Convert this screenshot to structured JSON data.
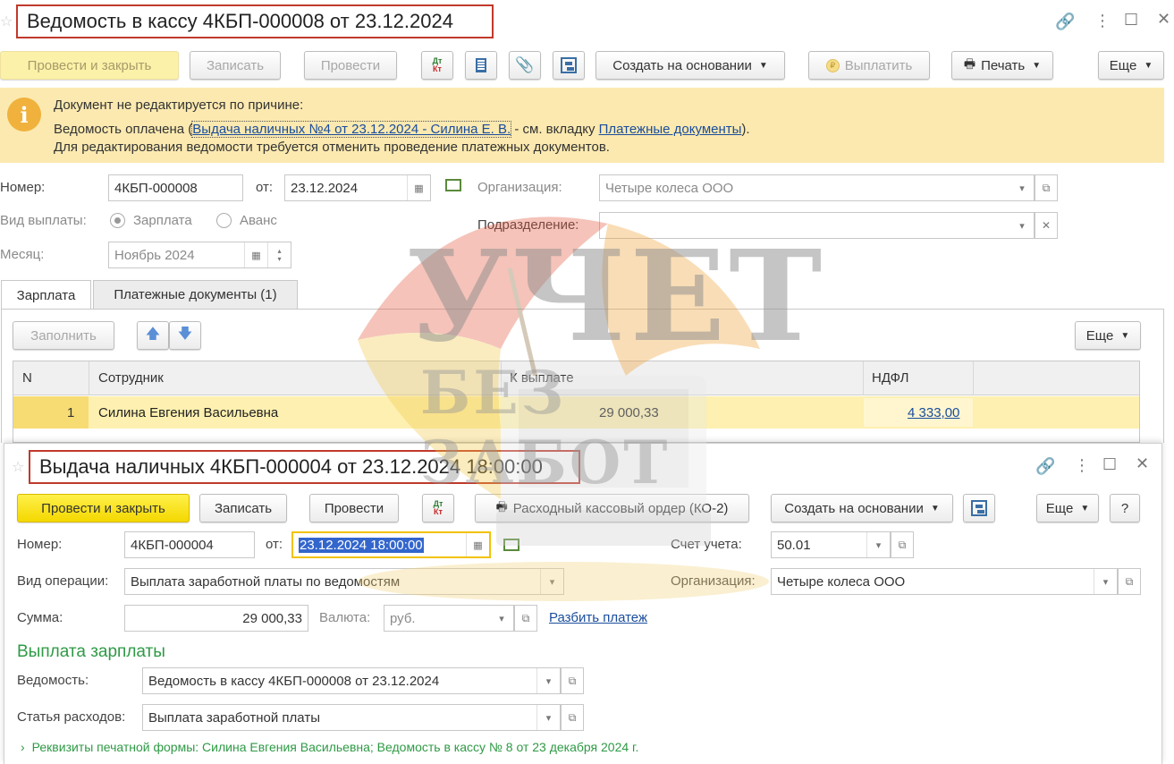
{
  "window1": {
    "title": "Ведомость в кассу 4КБП-000008 от 23.12.2024",
    "toolbar": {
      "post_close": "Провести и закрыть",
      "save": "Записать",
      "post": "Провести",
      "dt_kt": "Дт/Кт",
      "create_based": "Создать на основании",
      "pay": "Выплатить",
      "print": "Печать",
      "more": "Еще"
    },
    "notice": {
      "line1": "Документ не редактируется по причине:",
      "line2_prefix": "Ведомость оплачена (",
      "line2_link": "Выдача наличных №4 от 23.12.2024 - Силина Е. В.",
      "line2_mid": " - см. вкладку ",
      "line2_link2": "Платежные документы",
      "line2_suffix": ").",
      "line3": "Для редактирования ведомости требуется отменить проведение платежных документов."
    },
    "form": {
      "number_label": "Номер:",
      "number_value": "4КБП-000008",
      "date_label": "от:",
      "date_value": "23.12.2024",
      "org_label": "Организация:",
      "org_value": "Четыре колеса ООО",
      "dept_label": "Подразделение:",
      "dept_value": "",
      "pay_type_label": "Вид выплаты:",
      "pay_type_salary": "Зарплата",
      "pay_type_advance": "Аванс",
      "month_label": "Месяц:",
      "month_value": "Ноябрь 2024"
    },
    "tabs": [
      "Зарплата",
      "Платежные документы (1)"
    ],
    "tab_toolbar": {
      "fill": "Заполнить",
      "more": "Еще"
    },
    "table": {
      "headers": [
        "N",
        "Сотрудник",
        "К выплате",
        "НДФЛ"
      ],
      "rows": [
        {
          "n": "1",
          "employee": "Силина Евгения Васильевна",
          "amount": "29 000,33",
          "ndfl": "4 333,00"
        }
      ]
    }
  },
  "window2": {
    "title": "Выдача наличных 4КБП-000004 от 23.12.2024 18:00:00",
    "toolbar": {
      "post_close": "Провести и закрыть",
      "save": "Записать",
      "post": "Провести",
      "dt_kt": "Дт/Кт",
      "cash_order": "Расходный кассовый ордер (КО-2)",
      "create_based": "Создать на основании",
      "more": "Еще",
      "help": "?"
    },
    "form": {
      "number_label": "Номер:",
      "number_value": "4КБП-000004",
      "date_label": "от:",
      "date_value": "23.12.2024 18:00:00",
      "account_label": "Счет учета:",
      "account_value": "50.01",
      "op_type_label": "Вид операции:",
      "op_type_value": "Выплата заработной платы по ведомостям",
      "org_label": "Организация:",
      "org_value": "Четыре колеса ООО",
      "sum_label": "Сумма:",
      "sum_value": "29 000,33",
      "currency_label": "Валюта:",
      "currency_value": "руб.",
      "split_link": "Разбить платеж",
      "section_title": "Выплата зарплаты",
      "statement_label": "Ведомость:",
      "statement_value": "Ведомость в кассу 4КБП-000008 от 23.12.2024",
      "expense_label": "Статья расходов:",
      "expense_value": "Выплата заработной платы",
      "print_details": "Реквизиты печатной формы: Силина Евгения Васильевна; Ведомость в кассу № 8 от 23 декабря 2024 г."
    }
  },
  "watermark": {
    "line1": "УЧЕТ",
    "line2": "БЕЗ ЗАБОТ"
  },
  "colors": {
    "accent_yellow": "#f4d800",
    "notice_bg": "#fbe9b0",
    "title_border": "#c0392b",
    "link": "#1a4d9c",
    "section_green": "#2e9a45",
    "selected_row": "#fdf0b0"
  }
}
